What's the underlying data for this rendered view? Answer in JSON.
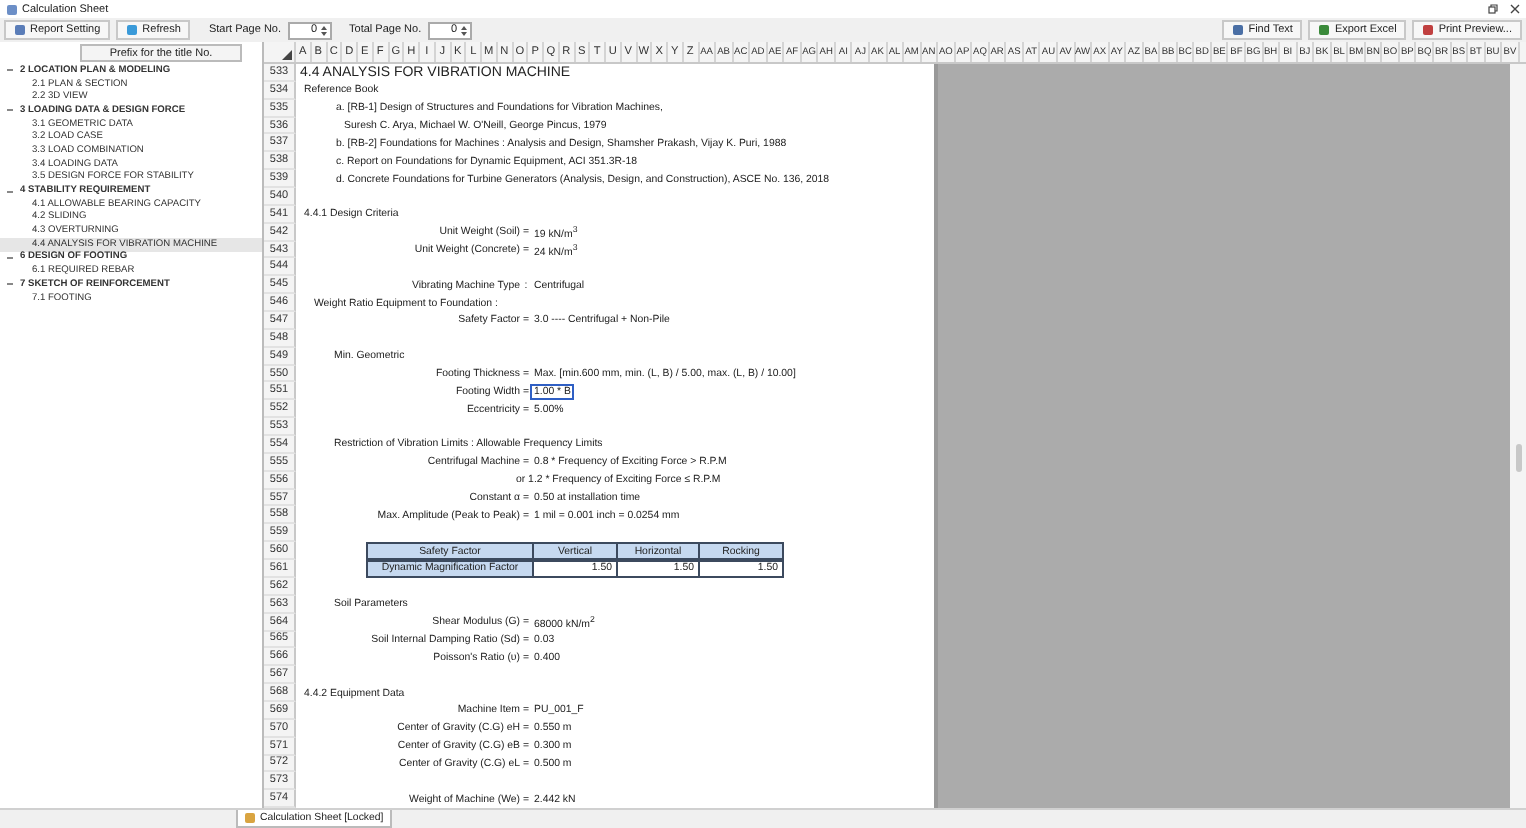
{
  "window": {
    "title": "Calculation Sheet"
  },
  "toolbar": {
    "buttons": [
      {
        "label": "Report Setting"
      },
      {
        "label": "Refresh"
      }
    ],
    "start_page": {
      "label": "Start Page No.",
      "value": "0"
    },
    "total_page": {
      "label": "Total Page No.",
      "value": "0"
    },
    "right_buttons": [
      {
        "label": "Find Text"
      },
      {
        "label": "Export Excel"
      },
      {
        "label": "Print Preview..."
      }
    ]
  },
  "sidebar": {
    "header": "Prefix for the title No.",
    "items": [
      {
        "label": "2 LOCATION PLAN & MODELING",
        "expanded": true,
        "selected": false,
        "children": [
          {
            "label": "2.1 PLAN & SECTION",
            "selected": false
          },
          {
            "label": "2.2 3D VIEW",
            "selected": false
          }
        ]
      },
      {
        "label": "3 LOADING DATA & DESIGN FORCE",
        "expanded": true,
        "selected": false,
        "children": [
          {
            "label": "3.1 GEOMETRIC DATA",
            "selected": false
          },
          {
            "label": "3.2 LOAD CASE",
            "selected": false
          },
          {
            "label": "3.3 LOAD COMBINATION",
            "selected": false
          },
          {
            "label": "3.4 LOADING DATA",
            "selected": false
          },
          {
            "label": "3.5 DESIGN FORCE FOR STABILITY",
            "selected": false
          }
        ]
      },
      {
        "label": "4 STABILITY REQUIREMENT",
        "expanded": true,
        "selected": false,
        "children": [
          {
            "label": "4.1 ALLOWABLE BEARING CAPACITY",
            "selected": false
          },
          {
            "label": "4.2 SLIDING",
            "selected": false
          },
          {
            "label": "4.3 OVERTURNING",
            "selected": false
          },
          {
            "label": "4.4 ANALYSIS FOR VIBRATION MACHINE",
            "selected": true
          }
        ]
      },
      {
        "label": "6 DESIGN OF FOOTING",
        "expanded": true,
        "selected": false,
        "children": [
          {
            "label": "6.1 REQUIRED REBAR",
            "selected": false
          }
        ]
      },
      {
        "label": "7 SKETCH OF REINFORCEMENT",
        "expanded": true,
        "selected": false,
        "children": [
          {
            "label": "7.1 FOOTING",
            "selected": false
          }
        ]
      }
    ]
  },
  "columns": [
    "A",
    "B",
    "C",
    "D",
    "E",
    "F",
    "G",
    "H",
    "I",
    "J",
    "K",
    "L",
    "M",
    "N",
    "O",
    "P",
    "Q",
    "R",
    "S",
    "T",
    "U",
    "V",
    "W",
    "X",
    "Y",
    "Z",
    "AA",
    "AB",
    "AC",
    "AD",
    "AE",
    "AF",
    "AG",
    "AH",
    "AI",
    "AJ",
    "AK",
    "AL",
    "AM",
    "AN",
    "AO",
    "AP",
    "AQ",
    "AR",
    "AS",
    "AT",
    "AU",
    "AV",
    "AW",
    "AX",
    "AY",
    "AZ",
    "BA",
    "BB",
    "BC",
    "BD",
    "BE",
    "BF",
    "BG",
    "BH",
    "BI",
    "BJ",
    "BK",
    "BL",
    "BM",
    "BN",
    "BO",
    "BP",
    "BQ",
    "BR",
    "BS",
    "BT",
    "BU",
    "BV"
  ],
  "rows": [
    {
      "num": "533",
      "kind": "title",
      "text": "4.4 ANALYSIS FOR VIBRATION MACHINE"
    },
    {
      "num": "534",
      "kind": "heading",
      "text": "Reference Book"
    },
    {
      "num": "535",
      "kind": "ref",
      "text": "a. [RB-1] Design of Structures and Foundations for Vibration Machines,"
    },
    {
      "num": "536",
      "kind": "ref-cont",
      "text": "Suresh C. Arya, Michael W. O'Neill, George Pincus, 1979"
    },
    {
      "num": "537",
      "kind": "ref",
      "text": "b. [RB-2] Foundations for Machines : Analysis and Design, Shamsher Prakash, Vijay K. Puri, 1988"
    },
    {
      "num": "538",
      "kind": "ref",
      "text": "c. Report on Foundations for Dynamic Equipment, ACI 351.3R-18"
    },
    {
      "num": "539",
      "kind": "ref",
      "text": "d. Concrete Foundations for Turbine Generators (Analysis, Design, and Construction), ASCE No. 136, 2018"
    },
    {
      "num": "540",
      "kind": "blank"
    },
    {
      "num": "541",
      "kind": "heading",
      "text": "4.4.1 Design Criteria"
    },
    {
      "num": "542",
      "kind": "eq",
      "label": "Unit Weight (Soil)",
      "sep": "=",
      "value": "19 kN/m$^{3}$",
      "selected": false
    },
    {
      "num": "543",
      "kind": "eq",
      "label": "Unit Weight (Concrete)",
      "sep": "=",
      "value": "24 kN/m$^{3}$",
      "selected": false
    },
    {
      "num": "544",
      "kind": "blank"
    },
    {
      "num": "545",
      "kind": "eq",
      "label": "Vibrating Machine Type",
      "sep": ":",
      "value": "Centrifugal",
      "selected": false
    },
    {
      "num": "546",
      "kind": "subheading",
      "text": "Weight Ratio Equipment to Foundation :"
    },
    {
      "num": "547",
      "kind": "eq",
      "label": "Safety Factor",
      "sep": "=",
      "value": "3.0 ---- Centrifugal + Non-Pile",
      "selected": false
    },
    {
      "num": "548",
      "kind": "blank"
    },
    {
      "num": "549",
      "kind": "note",
      "text": "Min. Geometric"
    },
    {
      "num": "550",
      "kind": "eq",
      "label": "Footing Thickness",
      "sep": "=",
      "value": "Max. [min.600 mm, min. (L, B) / 5.00, max. (L, B) / 10.00]",
      "selected": false
    },
    {
      "num": "551",
      "kind": "eq",
      "label": "Footing Width",
      "sep": "=",
      "value": "1.00 * B",
      "selected": true
    },
    {
      "num": "552",
      "kind": "eq",
      "label": "Eccentricity",
      "sep": "=",
      "value": "5.00%",
      "selected": false
    },
    {
      "num": "553",
      "kind": "blank"
    },
    {
      "num": "554",
      "kind": "note",
      "text": "Restriction of Vibration Limits : Allowable Frequency Limits"
    },
    {
      "num": "555",
      "kind": "eq",
      "label": "Centrifugal Machine",
      "sep": "=",
      "value": "0.8 * Frequency of Exciting Force > R.P.M",
      "selected": false
    },
    {
      "num": "556",
      "kind": "eq-cont",
      "value": "or 1.2 * Frequency of Exciting Force ≤ R.P.M"
    },
    {
      "num": "557",
      "kind": "eq",
      "label": "Constant α",
      "sep": "=",
      "value": "0.50 at installation time",
      "selected": false
    },
    {
      "num": "558",
      "kind": "eq",
      "label": "Max. Amplitude (Peak to Peak)",
      "sep": "=",
      "value": "1 mil = 0.001 inch = 0.0254 mm",
      "selected": false
    },
    {
      "num": "559",
      "kind": "blank"
    },
    {
      "num": "560",
      "kind": "table-head",
      "cells": [
        "Safety Factor",
        "Vertical",
        "Horizontal",
        "Rocking"
      ]
    },
    {
      "num": "561",
      "kind": "table-row",
      "cells": [
        "Dynamic Magnification Factor",
        "1.50",
        "1.50",
        "1.50"
      ]
    },
    {
      "num": "562",
      "kind": "blank"
    },
    {
      "num": "563",
      "kind": "note",
      "text": "Soil Parameters"
    },
    {
      "num": "564",
      "kind": "eq",
      "label": "Shear Modulus (G)",
      "sep": "=",
      "value": "68000 kN/m$^{2}$",
      "selected": false
    },
    {
      "num": "565",
      "kind": "eq",
      "label": "Soil Internal Damping Ratio (Sd)",
      "sep": "=",
      "value": "0.03",
      "selected": false
    },
    {
      "num": "566",
      "kind": "eq",
      "label": "Poisson's Ratio (υ)",
      "sep": "=",
      "value": "0.400",
      "selected": false
    },
    {
      "num": "567",
      "kind": "blank"
    },
    {
      "num": "568",
      "kind": "heading",
      "text": "4.4.2 Equipment Data"
    },
    {
      "num": "569",
      "kind": "eq",
      "label": "Machine Item",
      "sep": "=",
      "value": "PU_001_F",
      "selected": false
    },
    {
      "num": "570",
      "kind": "eq",
      "label": "Center of Gravity (C.G) eH",
      "sep": "=",
      "value": "0.550 m",
      "selected": false
    },
    {
      "num": "571",
      "kind": "eq",
      "label": "Center of Gravity (C.G) eB",
      "sep": "=",
      "value": "0.300 m",
      "selected": false
    },
    {
      "num": "572",
      "kind": "eq",
      "label": "Center of Gravity (C.G) eL",
      "sep": "=",
      "value": "0.500 m",
      "selected": false
    },
    {
      "num": "573",
      "kind": "blank"
    },
    {
      "num": "574",
      "kind": "eq",
      "label": "Weight of Machine (We)",
      "sep": "=",
      "value": "2.442 kN",
      "selected": false
    }
  ],
  "sheet_tabs": [
    {
      "label": "Calculation Sheet [Locked]",
      "selected": true
    }
  ]
}
